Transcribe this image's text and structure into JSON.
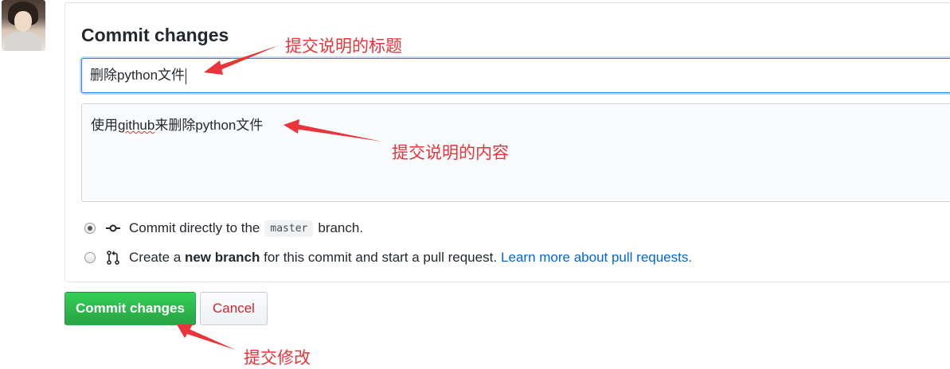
{
  "dialog": {
    "title": "Commit changes",
    "summary_value": "删除python文件",
    "description_value_before": "使用",
    "description_value_spell": "github",
    "description_value_after": "来删除python文件",
    "options": [
      {
        "selected": true,
        "text_before": "Commit directly to the",
        "branch_code": "master",
        "text_after": "branch."
      },
      {
        "selected": false,
        "text_before": "Create a",
        "bold": "new branch",
        "text_after": "for this commit and start a pull request.",
        "link": "Learn more about pull requests."
      }
    ],
    "commit_button": "Commit changes",
    "cancel_button": "Cancel"
  },
  "annotations": {
    "title_note": "提交说明的标题",
    "content_note": "提交说明的内容",
    "commit_note": "提交修改"
  },
  "colors": {
    "annotation": "#e8343a",
    "primary_button": "#28a745",
    "cancel_text": "#cb2431",
    "link": "#0366d6"
  },
  "icons": [
    "git-commit-icon",
    "git-pull-request-icon"
  ]
}
